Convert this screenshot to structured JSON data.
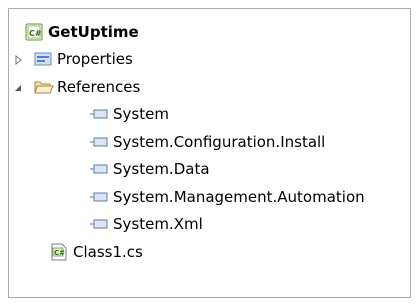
{
  "tree": {
    "project": {
      "label": "GetUptime",
      "icon": "csharp-project-icon"
    },
    "properties": {
      "label": "Properties",
      "icon": "properties-folder-icon",
      "expanded": false
    },
    "references": {
      "label": "References",
      "icon": "open-folder-icon",
      "expanded": true,
      "items": [
        {
          "label": "System",
          "icon": "assembly-reference-icon"
        },
        {
          "label": "System.Configuration.Install",
          "icon": "assembly-reference-icon"
        },
        {
          "label": "System.Data",
          "icon": "assembly-reference-icon"
        },
        {
          "label": "System.Management.Automation",
          "icon": "assembly-reference-icon"
        },
        {
          "label": "System.Xml",
          "icon": "assembly-reference-icon"
        }
      ]
    },
    "file": {
      "label": "Class1.cs",
      "icon": "csharp-file-icon"
    }
  }
}
